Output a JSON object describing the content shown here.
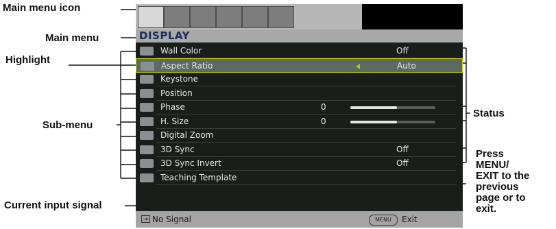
{
  "callouts": {
    "main_menu_icon": "Main menu icon",
    "main_menu": "Main menu",
    "highlight": "Highlight",
    "sub_menu": "Sub-menu",
    "current_input_signal": "Current input signal",
    "status": "Status",
    "press_menu_exit": [
      "Press",
      "MENU/",
      "EXIT to the",
      "previous",
      "page or to",
      "exit."
    ]
  },
  "osd": {
    "title": "DISPLAY",
    "items": [
      {
        "icon": "wall-color-icon",
        "label": "Wall Color",
        "value": "Off"
      },
      {
        "icon": "aspect-ratio-icon",
        "label": "Aspect Ratio",
        "value": "Auto",
        "highlighted": true
      },
      {
        "icon": "keystone-icon",
        "label": "Keystone",
        "value": ""
      },
      {
        "icon": "position-icon",
        "label": "Position",
        "value": ""
      },
      {
        "icon": "phase-icon",
        "label": "Phase",
        "number": "0",
        "slider_fraction": 0.55
      },
      {
        "icon": "h-size-icon",
        "label": "H. Size",
        "number": "0",
        "slider_fraction": 0.55
      },
      {
        "icon": "digital-zoom-icon",
        "label": "Digital Zoom",
        "value": ""
      },
      {
        "icon": "3d-sync-icon",
        "label": "3D Sync",
        "value": "Off"
      },
      {
        "icon": "3d-sync-invert-icon",
        "label": "3D Sync Invert",
        "value": "Off"
      },
      {
        "icon": "teaching-template-icon",
        "label": "Teaching Template",
        "value": ""
      }
    ],
    "bottom": {
      "signal": "No Signal",
      "menu_key": "MENU",
      "exit": "Exit"
    }
  }
}
